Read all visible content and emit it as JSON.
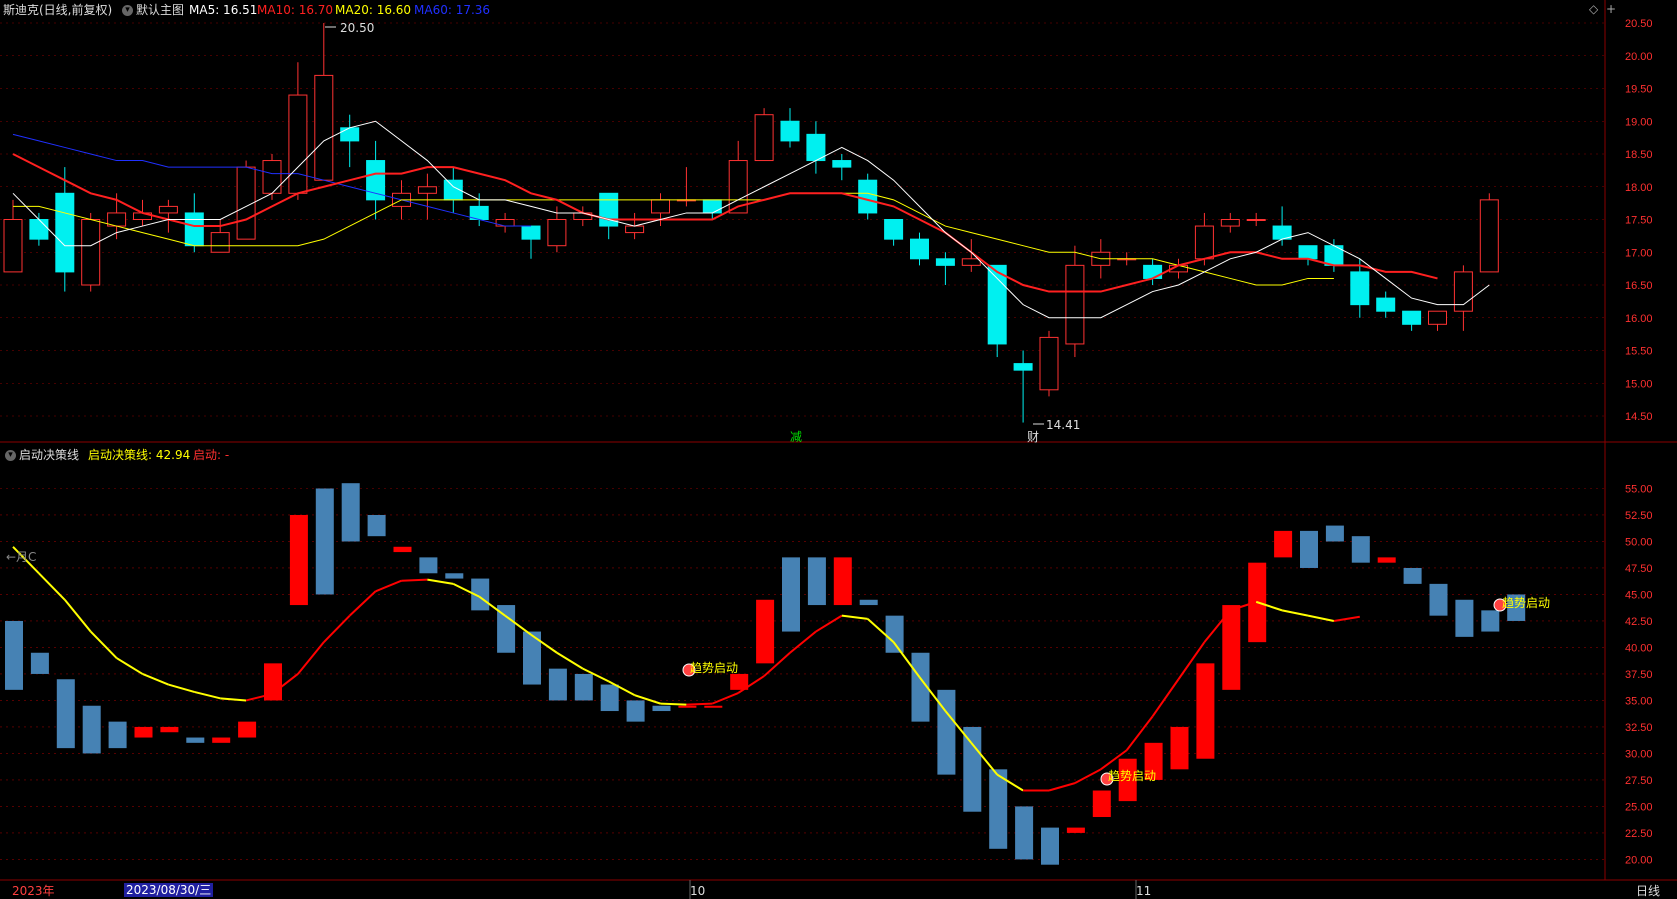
{
  "header": {
    "stock_name": "斯迪克(日线,前复权)",
    "template": "默认主图",
    "ma": [
      {
        "label": "MA5: 16.51",
        "color": "#ffffff"
      },
      {
        "label": "MA10: 16.70",
        "color": "#ff2020"
      },
      {
        "label": "MA20: 16.60",
        "color": "#ffff00"
      },
      {
        "label": "MA60: 17.36",
        "color": "#2030ff"
      }
    ]
  },
  "indicator": {
    "name": "启动决策线",
    "value_label": "启动决策线: 42.94",
    "signal_label": "启动: -",
    "signal_text": "趋势启动"
  },
  "annotations": {
    "high": "20.50",
    "low": "14.41",
    "mark_jian": "减",
    "mark_cai": "财",
    "month_arrow": "←月C"
  },
  "bottom_bar": {
    "year": "2023年",
    "date": "2023/08/30/三",
    "month10": "10",
    "month11": "11",
    "period": "日线"
  },
  "colors": {
    "up": "#ff3232",
    "down": "#00f0f0",
    "ind_up": "#ff0000",
    "ind_down": "#4682b4",
    "grid": "#8b0000"
  },
  "chart_data": {
    "type": "candlestick",
    "price_axis": {
      "min": 14.5,
      "max": 20.5,
      "ticks": [
        "20.50",
        "20.00",
        "19.50",
        "19.00",
        "18.50",
        "18.00",
        "17.50",
        "17.00",
        "16.50",
        "16.00",
        "15.50",
        "15.00",
        "14.50"
      ]
    },
    "candles": [
      [
        16.7,
        17.5,
        17.8,
        16.7
      ],
      [
        17.5,
        17.2,
        17.6,
        17.1
      ],
      [
        17.9,
        16.7,
        18.3,
        16.4
      ],
      [
        16.5,
        17.5,
        17.6,
        16.4
      ],
      [
        17.4,
        17.6,
        17.9,
        17.2
      ],
      [
        17.5,
        17.6,
        17.8,
        17.4
      ],
      [
        17.6,
        17.7,
        17.8,
        17.3
      ],
      [
        17.6,
        17.1,
        17.9,
        17.0
      ],
      [
        17.0,
        17.3,
        17.5,
        17.0
      ],
      [
        17.2,
        18.3,
        18.4,
        17.2
      ],
      [
        17.9,
        18.4,
        18.5,
        17.8
      ],
      [
        17.9,
        19.4,
        19.9,
        17.8
      ],
      [
        18.1,
        19.7,
        20.5,
        18.1
      ],
      [
        18.9,
        18.7,
        19.1,
        18.3
      ],
      [
        18.4,
        17.8,
        18.7,
        17.5
      ],
      [
        17.7,
        17.9,
        18.1,
        17.5
      ],
      [
        17.9,
        18.0,
        18.2,
        17.5
      ],
      [
        18.1,
        17.8,
        18.3,
        17.6
      ],
      [
        17.7,
        17.5,
        17.9,
        17.4
      ],
      [
        17.4,
        17.5,
        17.6,
        17.3
      ],
      [
        17.4,
        17.2,
        17.4,
        16.9
      ],
      [
        17.1,
        17.5,
        17.7,
        17.0
      ],
      [
        17.5,
        17.6,
        17.7,
        17.4
      ],
      [
        17.9,
        17.4,
        17.9,
        17.2
      ],
      [
        17.3,
        17.4,
        17.6,
        17.2
      ],
      [
        17.6,
        17.8,
        17.9,
        17.4
      ],
      [
        17.8,
        17.8,
        18.3,
        17.7
      ],
      [
        17.8,
        17.6,
        17.8,
        17.5
      ],
      [
        17.6,
        18.4,
        18.7,
        17.6
      ],
      [
        18.4,
        19.1,
        19.2,
        18.4
      ],
      [
        19.0,
        18.7,
        19.2,
        18.6
      ],
      [
        18.8,
        18.4,
        19.0,
        18.2
      ],
      [
        18.4,
        18.3,
        18.5,
        18.1
      ],
      [
        18.1,
        17.6,
        18.2,
        17.5
      ],
      [
        17.5,
        17.2,
        17.5,
        17.1
      ],
      [
        17.2,
        16.9,
        17.3,
        16.8
      ],
      [
        16.9,
        16.8,
        17.0,
        16.5
      ],
      [
        16.8,
        16.9,
        17.2,
        16.7
      ],
      [
        16.8,
        15.6,
        16.8,
        15.4
      ],
      [
        15.3,
        15.2,
        15.5,
        14.4
      ],
      [
        14.9,
        15.7,
        15.8,
        14.8
      ],
      [
        15.6,
        16.8,
        17.1,
        15.4
      ],
      [
        16.8,
        17.0,
        17.2,
        16.6
      ],
      [
        16.9,
        16.9,
        17.0,
        16.8
      ],
      [
        16.8,
        16.6,
        16.9,
        16.5
      ],
      [
        16.7,
        16.8,
        16.9,
        16.6
      ],
      [
        16.9,
        17.4,
        17.6,
        16.8
      ],
      [
        17.4,
        17.5,
        17.6,
        17.3
      ],
      [
        17.5,
        17.5,
        17.6,
        17.4
      ],
      [
        17.4,
        17.2,
        17.7,
        17.1
      ],
      [
        17.1,
        16.9,
        17.1,
        16.8
      ],
      [
        17.1,
        16.8,
        17.2,
        16.7
      ],
      [
        16.7,
        16.2,
        16.9,
        16.0
      ],
      [
        16.3,
        16.1,
        16.4,
        16.0
      ],
      [
        16.1,
        15.9,
        16.1,
        15.8
      ],
      [
        15.9,
        16.1,
        16.1,
        15.8
      ],
      [
        16.1,
        16.7,
        16.8,
        15.8
      ],
      [
        16.7,
        17.8,
        17.9,
        16.7
      ]
    ],
    "ma5": [
      17.9,
      17.5,
      17.1,
      17.1,
      17.3,
      17.4,
      17.5,
      17.5,
      17.5,
      17.7,
      17.9,
      18.3,
      18.7,
      18.9,
      19.0,
      18.7,
      18.4,
      18.0,
      17.8,
      17.8,
      17.7,
      17.6,
      17.6,
      17.5,
      17.4,
      17.5,
      17.6,
      17.6,
      17.8,
      18.0,
      18.2,
      18.4,
      18.6,
      18.4,
      18.1,
      17.7,
      17.3,
      17.0,
      16.6,
      16.2,
      16.0,
      16.0,
      16.0,
      16.2,
      16.4,
      16.5,
      16.7,
      16.9,
      17.0,
      17.2,
      17.3,
      17.1,
      16.9,
      16.6,
      16.3,
      16.2,
      16.2,
      16.5
    ],
    "ma10": [
      18.5,
      18.3,
      18.1,
      17.9,
      17.8,
      17.6,
      17.5,
      17.4,
      17.4,
      17.5,
      17.7,
      17.9,
      18.0,
      18.1,
      18.2,
      18.2,
      18.3,
      18.3,
      18.2,
      18.1,
      17.9,
      17.8,
      17.6,
      17.5,
      17.5,
      17.5,
      17.5,
      17.5,
      17.7,
      17.8,
      17.9,
      17.9,
      17.9,
      17.8,
      17.7,
      17.5,
      17.3,
      17.0,
      16.7,
      16.5,
      16.4,
      16.4,
      16.4,
      16.5,
      16.6,
      16.8,
      16.9,
      17.0,
      17.0,
      16.9,
      16.9,
      16.8,
      16.8,
      16.7,
      16.7,
      16.6
    ],
    "ma20": [
      17.7,
      17.7,
      17.6,
      17.5,
      17.4,
      17.3,
      17.2,
      17.1,
      17.1,
      17.1,
      17.1,
      17.1,
      17.2,
      17.4,
      17.6,
      17.8,
      17.8,
      17.8,
      17.8,
      17.8,
      17.8,
      17.8,
      17.8,
      17.8,
      17.8,
      17.8,
      17.8,
      17.8,
      17.8,
      17.8,
      17.9,
      17.9,
      17.9,
      17.9,
      17.8,
      17.6,
      17.4,
      17.3,
      17.2,
      17.1,
      17.0,
      17.0,
      16.9,
      16.9,
      16.9,
      16.8,
      16.7,
      16.6,
      16.5,
      16.5,
      16.6,
      16.6
    ],
    "ma60": [
      18.8,
      18.7,
      18.6,
      18.5,
      18.4,
      18.4,
      18.3,
      18.3,
      18.3,
      18.3,
      18.2,
      18.2,
      18.1,
      18.0,
      17.9,
      17.8,
      17.7,
      17.6,
      17.5,
      17.4,
      17.4
    ],
    "indicator": {
      "y_axis": {
        "min": 19,
        "max": 57.5,
        "ticks": [
          "55.00",
          "52.50",
          "50.00",
          "47.50",
          "45.00",
          "42.50",
          "40.00",
          "37.50",
          "35.00",
          "32.50",
          "30.00",
          "27.50",
          "25.00",
          "22.50",
          "20.00"
        ]
      },
      "bars": [
        [
          42.5,
          36.0
        ],
        [
          39.5,
          37.5
        ],
        [
          37.0,
          30.5
        ],
        [
          34.5,
          30.0
        ],
        [
          33.0,
          30.5
        ],
        [
          31.5,
          32.5
        ],
        [
          32.0,
          32.5
        ],
        [
          31.5,
          31.0
        ],
        [
          31.0,
          31.5
        ],
        [
          31.5,
          33.0
        ],
        [
          35.0,
          38.5
        ],
        [
          44.0,
          52.5
        ],
        [
          55.0,
          45.0
        ],
        [
          55.5,
          50.0
        ],
        [
          52.5,
          50.5
        ],
        [
          49.0,
          49.5
        ],
        [
          48.5,
          47.0
        ],
        [
          47.0,
          46.5
        ],
        [
          46.5,
          43.5
        ],
        [
          44.0,
          39.5
        ],
        [
          41.5,
          36.5
        ],
        [
          38.0,
          35.0
        ],
        [
          37.5,
          35.0
        ],
        [
          36.5,
          34.0
        ],
        [
          35.0,
          33.0
        ],
        [
          34.5,
          34.0
        ],
        [
          34.5,
          34.5
        ],
        [
          34.5,
          34.5
        ],
        [
          36.0,
          37.5
        ],
        [
          38.5,
          44.5
        ],
        [
          48.5,
          41.5
        ],
        [
          48.5,
          44.0
        ],
        [
          44.0,
          48.5
        ],
        [
          44.5,
          44.0
        ],
        [
          43.0,
          39.5
        ],
        [
          39.5,
          33.0
        ],
        [
          36.0,
          28.0
        ],
        [
          32.5,
          24.5
        ],
        [
          28.5,
          21.0
        ],
        [
          25.0,
          20.0
        ],
        [
          23.0,
          19.5
        ],
        [
          22.5,
          23.0
        ],
        [
          24.0,
          26.5
        ],
        [
          25.5,
          29.5
        ],
        [
          27.5,
          31.0
        ],
        [
          28.5,
          32.5
        ],
        [
          29.5,
          38.5
        ],
        [
          36.0,
          44.0
        ],
        [
          40.5,
          48.0
        ],
        [
          48.5,
          51.0
        ],
        [
          51.0,
          47.5
        ],
        [
          51.5,
          50.0
        ],
        [
          50.5,
          48.0
        ],
        [
          48.0,
          48.5
        ],
        [
          47.5,
          46.0
        ],
        [
          46.0,
          43.0
        ],
        [
          44.5,
          41.0
        ],
        [
          43.5,
          41.5
        ],
        [
          45.0,
          42.5
        ]
      ],
      "decision_line": [
        49.5,
        47.0,
        44.5,
        41.5,
        39.0,
        37.5,
        36.5,
        35.8,
        35.2,
        35.0,
        35.6,
        37.5,
        40.5,
        43.0,
        45.3,
        46.3,
        46.4,
        46.0,
        44.8,
        43.0,
        41.2,
        39.5,
        38.0,
        36.8,
        35.5,
        34.7,
        34.6,
        34.7,
        35.7,
        37.3,
        39.5,
        41.5,
        43.0,
        42.7,
        40.5,
        37.2,
        34.0,
        31.0,
        28.0,
        26.5,
        26.5,
        27.2,
        28.5,
        30.3,
        33.5,
        37.0,
        40.5,
        43.5,
        44.3,
        43.5,
        43.0,
        42.5,
        42.9
      ]
    }
  }
}
